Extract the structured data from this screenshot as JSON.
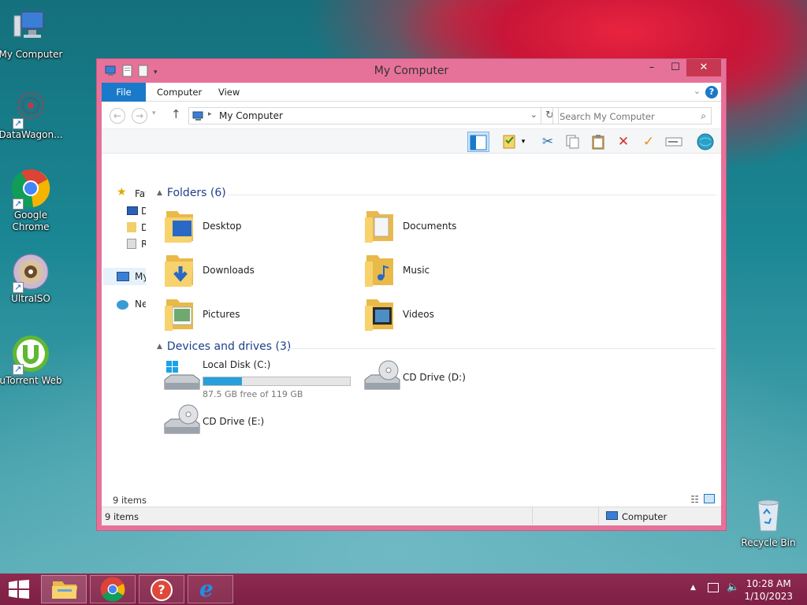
{
  "desktop": {
    "icons": [
      {
        "label": "My Computer"
      },
      {
        "label": "DataWagon..."
      },
      {
        "label": "Google Chrome"
      },
      {
        "label": "UltraISO"
      },
      {
        "label": "uTorrent Web"
      },
      {
        "label": "Recycle Bin"
      }
    ]
  },
  "window": {
    "title": "My Computer",
    "tabs": {
      "file": "File",
      "computer": "Computer",
      "view": "View"
    },
    "help": "?",
    "address": {
      "path": "My Computer"
    },
    "search": {
      "placeholder": "Search My Computer"
    },
    "nav": {
      "favorites": "Favorites",
      "item1": "Desktop",
      "item2": "Downloads",
      "item3": "Recent places",
      "computer": "My Computer",
      "network": "Network"
    },
    "folders_header": "Folders (6)",
    "folders": [
      {
        "name": "Desktop"
      },
      {
        "name": "Documents"
      },
      {
        "name": "Downloads"
      },
      {
        "name": "Music"
      },
      {
        "name": "Pictures"
      },
      {
        "name": "Videos"
      }
    ],
    "drives_header": "Devices and drives (3)",
    "drives": [
      {
        "name": "Local Disk (C:)",
        "free_text": "87.5 GB free of 119 GB",
        "used_fraction": 0.265
      },
      {
        "name": "CD Drive (D:)"
      },
      {
        "name": "CD Drive (E:)"
      }
    ],
    "details_count": "9 items",
    "status_count": "9 items",
    "status_location": "Computer"
  },
  "taskbar": {
    "time": "10:28 AM",
    "date": "1/10/2023"
  },
  "colors": {
    "window_frame": "#e6729a",
    "accent": "#1979ca",
    "taskbar": "#8e2a4f",
    "close_button": "#c7374f"
  }
}
